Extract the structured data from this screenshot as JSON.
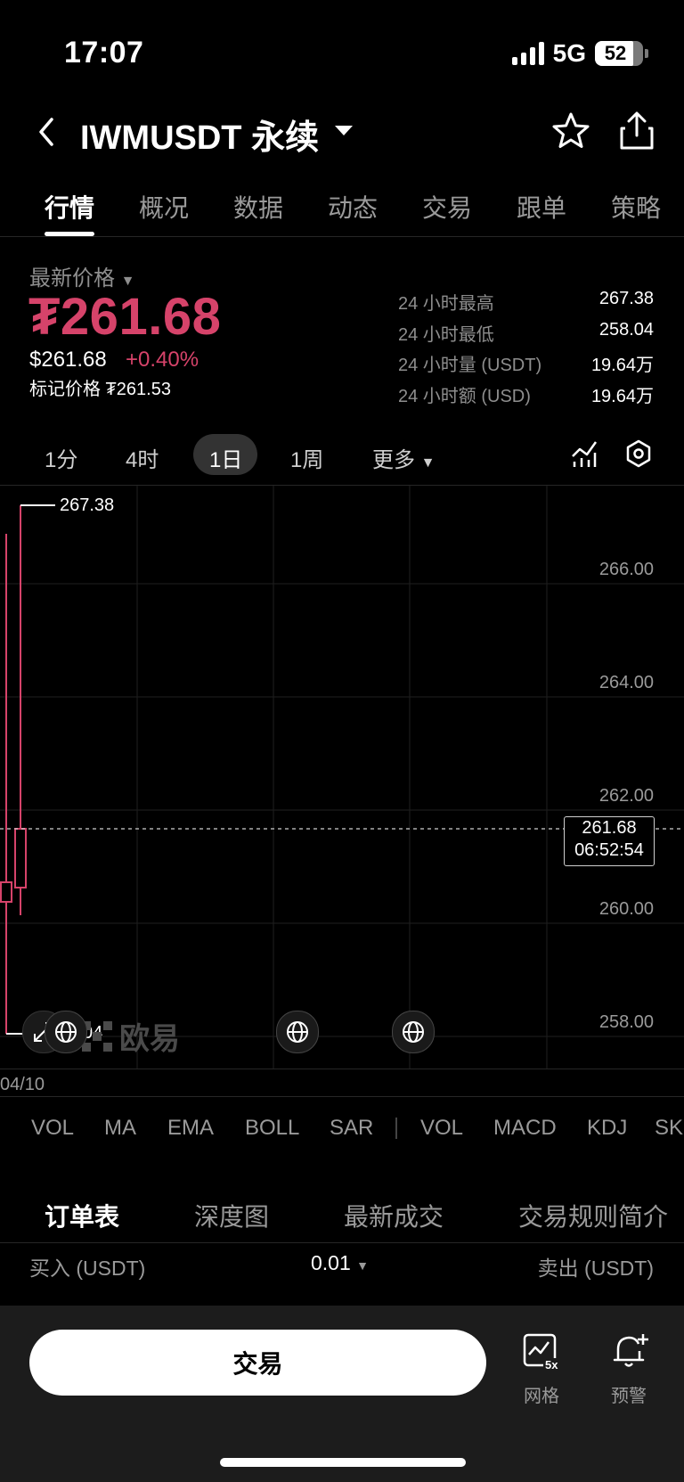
{
  "status": {
    "time": "17:07",
    "network": "5G",
    "battery": "52"
  },
  "header": {
    "title": "IWMUSDT 永续"
  },
  "tabs": [
    "行情",
    "概况",
    "数据",
    "动态",
    "交易",
    "跟单",
    "策略"
  ],
  "price": {
    "label": "最新价格",
    "last": "₮261.68",
    "usd": "$261.68",
    "change": "+0.40%",
    "mark": "标记价格 ₮261.53"
  },
  "stats": [
    {
      "label": "24 小时最高",
      "value": "267.38"
    },
    {
      "label": "24 小时最低",
      "value": "258.04"
    },
    {
      "label": "24 小时量 (USDT)",
      "value": "19.64万"
    },
    {
      "label": "24 小时额 (USD)",
      "value": "19.64万"
    }
  ],
  "timeframes": {
    "items": [
      "1分",
      "4时",
      "1日",
      "1周"
    ],
    "more": "更多",
    "selected": "1日"
  },
  "chart": {
    "high_marker": "267.38",
    "low_marker_partial": "04",
    "axis": [
      "266.00",
      "264.00",
      "262.00",
      "260.00",
      "258.00"
    ],
    "current_price": "261.68",
    "countdown": "06:52:54",
    "date": "04/10",
    "watermark": "欧易",
    "up_color": "#d6436a"
  },
  "indicators": [
    "VOL",
    "MA",
    "EMA",
    "BOLL",
    "SAR",
    "VOL",
    "MACD",
    "KDJ",
    "SK"
  ],
  "book_tabs": [
    "订单表",
    "深度图",
    "最新成交",
    "交易规则简介"
  ],
  "book_header": {
    "buy": "买入 (USDT)",
    "step": "0.01",
    "sell": "卖出 (USDT)"
  },
  "bottom": {
    "trade": "交易",
    "grid": "网格",
    "grid_badge": "5x",
    "alert": "预警"
  }
}
